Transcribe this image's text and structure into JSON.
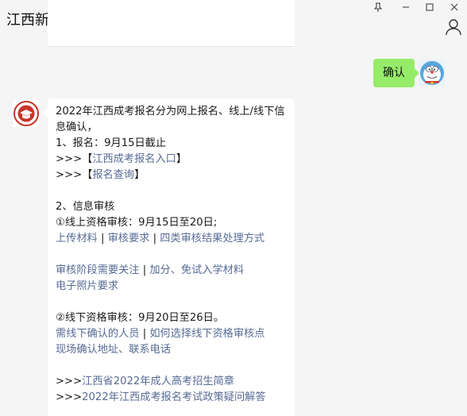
{
  "window": {
    "title": "江西新思路成考网",
    "controls": [
      "pin-icon",
      "minimize-icon",
      "maximize-icon",
      "close-icon"
    ],
    "pin_glyph": "⊥",
    "min_glyph": "—",
    "max_glyph": "☐",
    "close_glyph": "✕"
  },
  "sent_message": {
    "text": "确认"
  },
  "received_message": {
    "intro": "2022年江西成考报名分为网上报名、线上/线下信息确认，",
    "item1": "1、报名：9月15日截止",
    "link_prefix": ">>>",
    "link_open_bracket": "【",
    "link_close_bracket": "】",
    "link_entry": "江西成考报名入口",
    "link_query": "报名查询",
    "item2": "2、信息审核",
    "online_review": "①线上资格审核：9月15日至20日;",
    "separator": "|",
    "online_links_1": [
      "上传材料",
      "审核要求",
      "四类审核结果处理方式"
    ],
    "online_links_2": [
      "审核阶段需要关注",
      "加分、免试入学材料"
    ],
    "online_link_photo": "电子照片要求",
    "offline_review": "②线下资格审核：9月20日至26日。",
    "offline_links": [
      "需线下确认的人员",
      "如何选择线下资格审核点"
    ],
    "offline_link_site": "现场确认地址、联系电话",
    "guide_link": "江西省2022年成人高考招生简章",
    "faq_link": "2022年江西成考报名考试政策疑问解答"
  },
  "colors": {
    "background": "#f5f5f5",
    "sent_bubble": "#95ec69",
    "received_bubble": "#ffffff",
    "link": "#576b95"
  }
}
